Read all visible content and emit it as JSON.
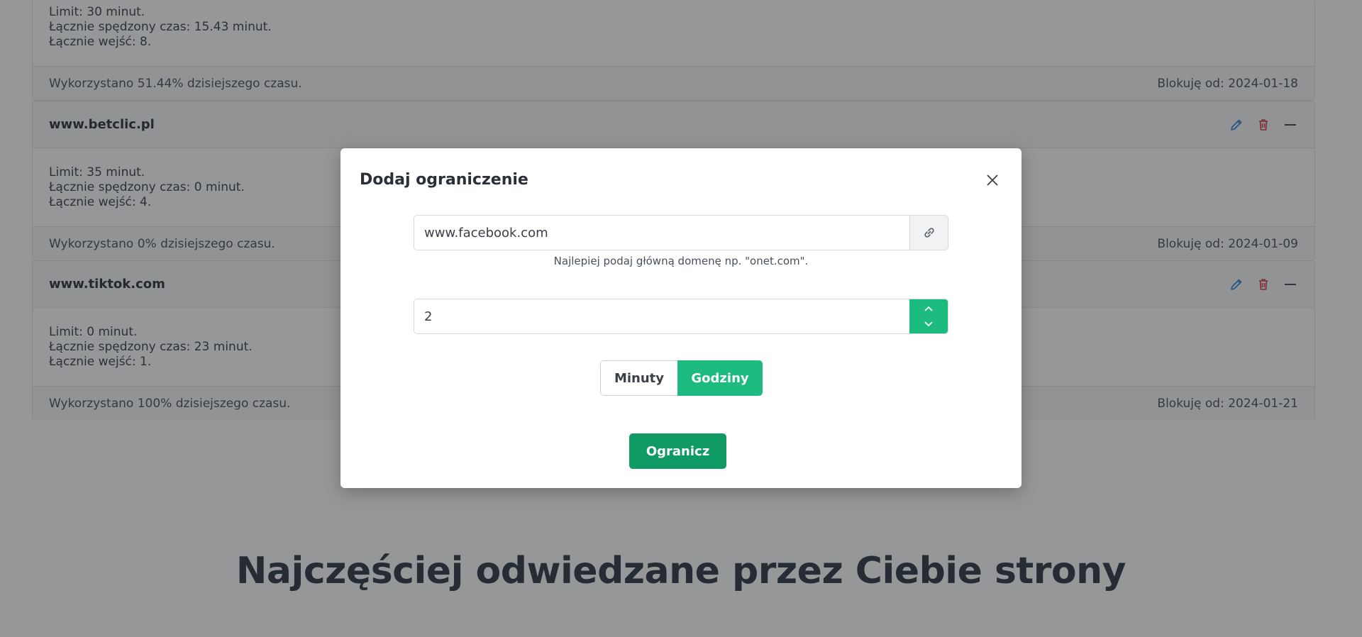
{
  "cards": [
    {
      "domain": "",
      "limit": "Limit: 30 minut.",
      "spent": "Łącznie spędzony czas: 15.43 minut.",
      "visits": "Łącznie wejść: 8.",
      "used": "Wykorzystano 51.44% dzisiejszego czasu.",
      "blocked": "Blokuję od: 2024-01-18"
    },
    {
      "domain": "www.betclic.pl",
      "limit": "Limit: 35 minut.",
      "spent": "Łącznie spędzony czas: 0 minut.",
      "visits": "Łącznie wejść: 4.",
      "used": "Wykorzystano 0% dzisiejszego czasu.",
      "blocked": "Blokuję od: 2024-01-09"
    },
    {
      "domain": "www.tiktok.com",
      "limit": "Limit: 0 minut.",
      "spent": "Łącznie spędzony czas: 23 minut.",
      "visits": "Łącznie wejść: 1.",
      "used": "Wykorzystano 100% dzisiejszego czasu.",
      "blocked": "Blokuję od: 2024-01-21"
    }
  ],
  "section_title": "Najczęściej odwiedzane przez Ciebie strony",
  "modal": {
    "title": "Dodaj ograniczenie",
    "url_value": "www.facebook.com",
    "url_help": "Najlepiej podaj główną domenę np. \"onet.com\".",
    "amount_value": "2",
    "unit_minutes": "Minuty",
    "unit_hours": "Godziny",
    "selected_unit": "Godziny",
    "submit_label": "Ogranicz"
  },
  "icons": {
    "edit": "pencil-icon",
    "delete": "trash-icon",
    "collapse": "minus-icon",
    "close": "close-icon",
    "link": "link-icon",
    "up": "chevron-up-icon",
    "down": "chevron-down-icon"
  },
  "colors": {
    "accent": "#1cbc80",
    "accent_dark": "#0f9a64",
    "edit": "#2f7fd6",
    "delete": "#d9363e"
  }
}
